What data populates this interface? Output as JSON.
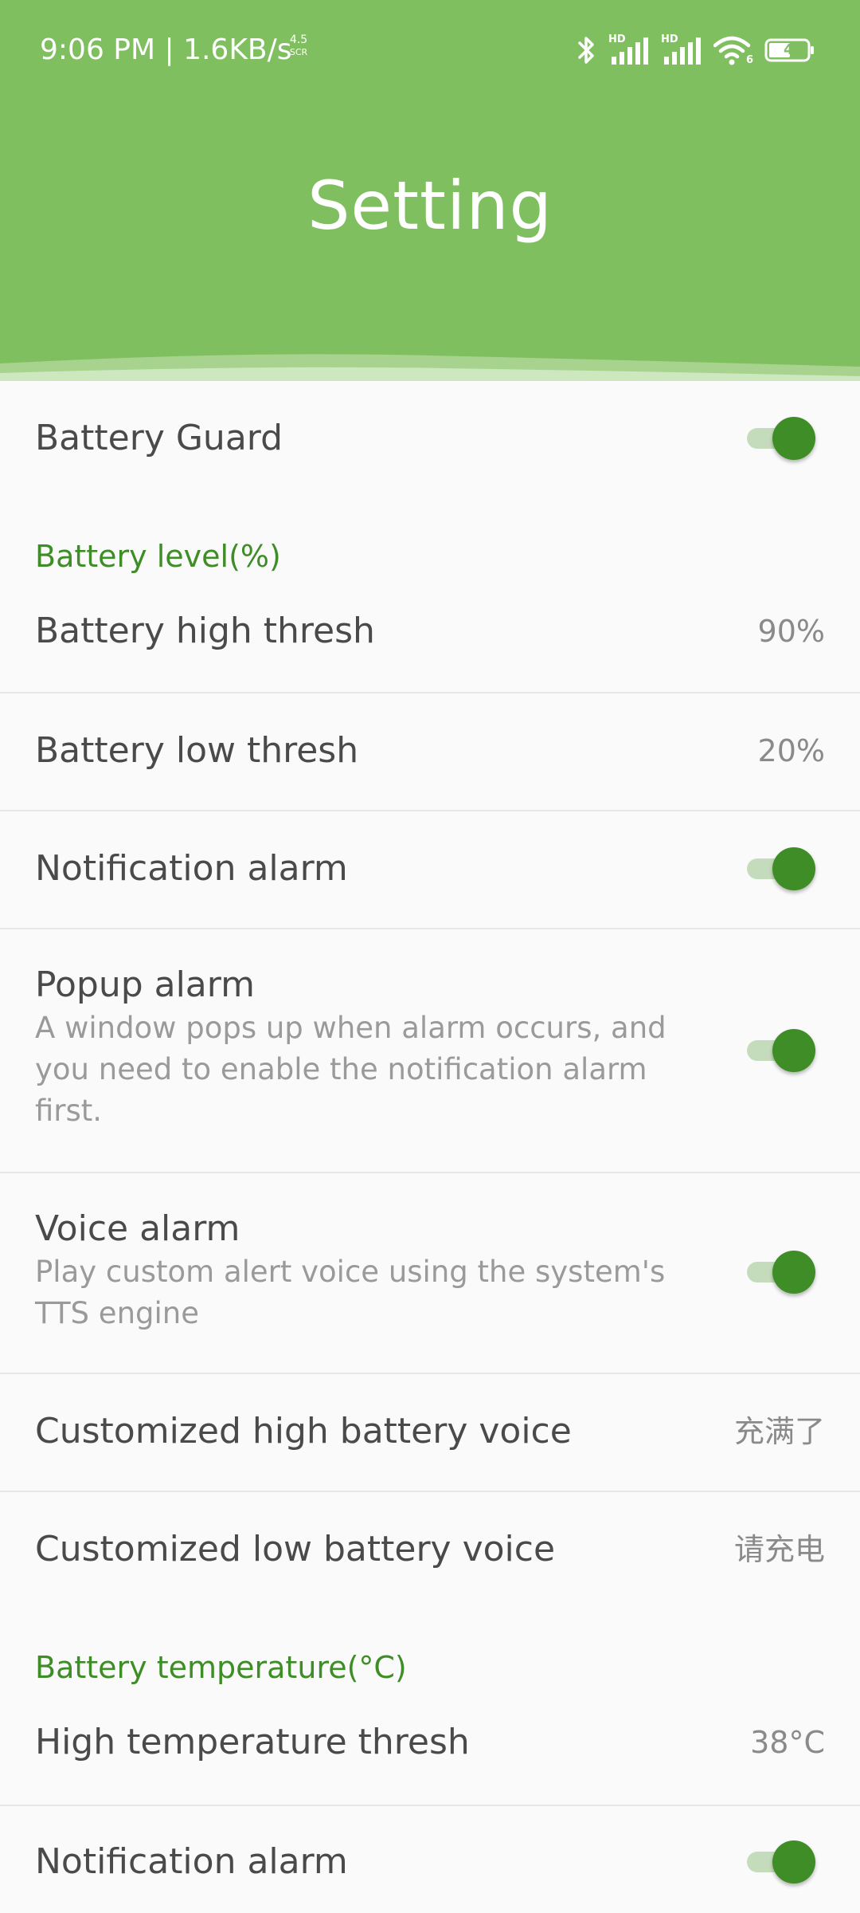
{
  "status_bar": {
    "time": "9:06 PM | 1.6KB/s",
    "net_top": "4.5",
    "net_bottom": "SCR",
    "hd_label": "HD",
    "wifi_label": "6",
    "battery_level": "4"
  },
  "header": {
    "title": "Setting",
    "background_color": "#7fbf5f"
  },
  "settings": {
    "battery_guard": {
      "title": "Battery Guard",
      "enabled": true
    },
    "battery_level_section": "Battery level(%)",
    "battery_high_thresh": {
      "title": "Battery high thresh",
      "value": "90%"
    },
    "battery_low_thresh": {
      "title": "Battery low thresh",
      "value": "20%"
    },
    "notification_alarm": {
      "title": "Notification alarm",
      "enabled": true
    },
    "popup_alarm": {
      "title": "Popup alarm",
      "summary": "A window pops up when alarm occurs, and you need to enable the notification alarm first.",
      "enabled": true
    },
    "voice_alarm": {
      "title": "Voice alarm",
      "summary": "Play custom alert voice using the system's TTS engine",
      "enabled": true
    },
    "custom_high_voice": {
      "title": "Customized high battery voice",
      "value": "充满了"
    },
    "custom_low_voice": {
      "title": "Customized low battery voice",
      "value": "请充电"
    },
    "battery_temp_section": "Battery temperature(°C)",
    "high_temp_thresh": {
      "title": "High temperature thresh",
      "value": "38°C"
    },
    "temp_notification_alarm": {
      "title": "Notification alarm",
      "enabled": true
    }
  },
  "colors": {
    "accent": "#3e8d26",
    "switch_track": "#c5dcbc",
    "text_primary": "#4a4a4a",
    "text_secondary": "#9a9a9a"
  }
}
